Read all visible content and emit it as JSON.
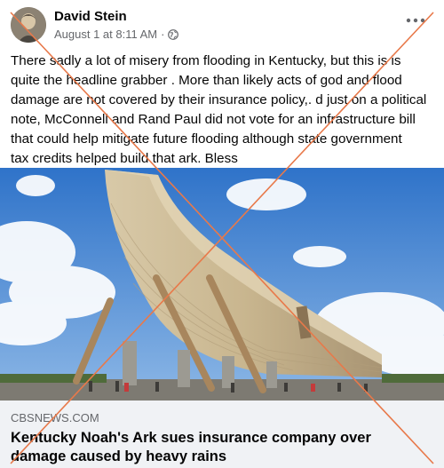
{
  "post": {
    "author": "David Stein",
    "timestamp": "August 1 at 8:11 AM",
    "separator": "·",
    "privacy_icon": "globe-icon",
    "more_icon": "more-dots-icon",
    "text_lines": [
      "There sadly a lot of misery from flooding in Kentucky, but this is is",
      "quite the headline grabber . More than likely acts of god and flood",
      "damage are not covered by their insurance policy,. d just on a political",
      "note, McConnell and Rand Paul did not vote for an infrastructure bill",
      "that could help mitigate future flooding although state government",
      "tax credits helped build that ark. Bless"
    ]
  },
  "link_preview": {
    "image_subject": "ark-image",
    "domain": "CBSNEWS.COM",
    "title_lines": [
      "Kentucky Noah's Ark sues insurance company over",
      "damage caused by heavy rains"
    ]
  },
  "overlay": {
    "cross_color": "#e8794a"
  },
  "colors": {
    "secondary_text": "#65676b",
    "footer_bg": "#f0f2f5",
    "sky": "#3b7fd0"
  }
}
